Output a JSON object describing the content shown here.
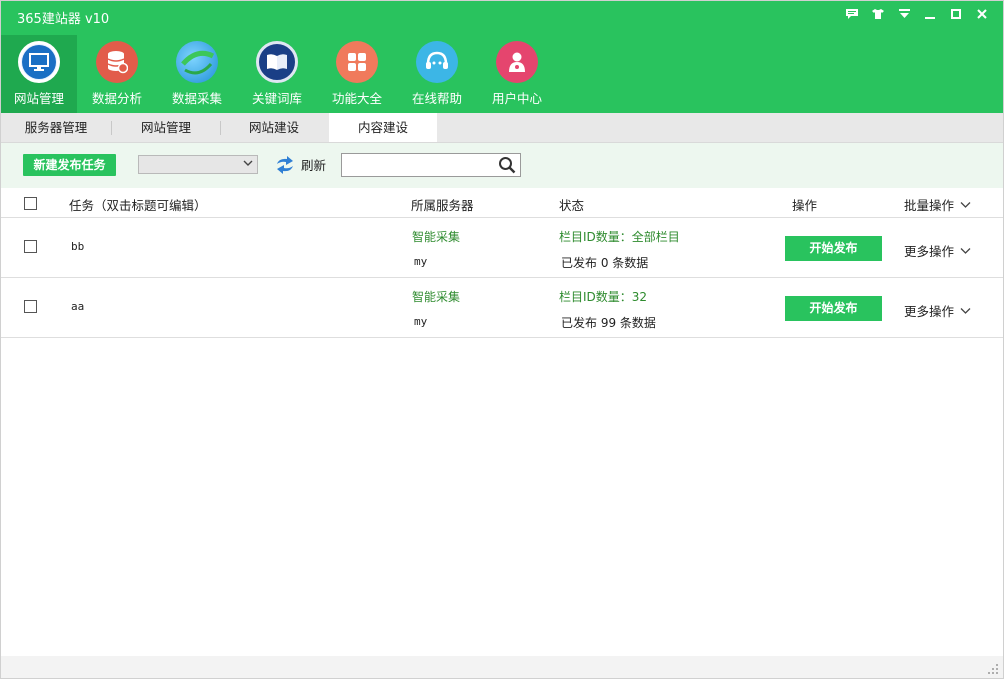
{
  "app": {
    "title": "365建站器 v10"
  },
  "window_controls": [
    {
      "name": "feedback-icon",
      "glyph": "▪"
    },
    {
      "name": "skin-icon",
      "glyph": "▪"
    },
    {
      "name": "menu-icon",
      "glyph": "▼"
    },
    {
      "name": "minimize-icon",
      "glyph": "—"
    },
    {
      "name": "maximize-icon",
      "glyph": "□"
    },
    {
      "name": "close-icon",
      "glyph": "✕"
    }
  ],
  "nav": {
    "items": [
      {
        "label": "网站管理",
        "icon": "monitor-icon",
        "color": "#1a6fc4",
        "active": true
      },
      {
        "label": "数据分析",
        "icon": "database-icon",
        "color": "#e25c4a",
        "active": false
      },
      {
        "label": "数据采集",
        "icon": "globe-icon",
        "color": "#1d8fd6",
        "active": false
      },
      {
        "label": "关键词库",
        "icon": "book-icon",
        "color": "#1a3f86",
        "active": false
      },
      {
        "label": "功能大全",
        "icon": "grid-icon",
        "color": "#f07a5c",
        "active": false
      },
      {
        "label": "在线帮助",
        "icon": "headset-icon",
        "color": "#3cb6e6",
        "active": false
      },
      {
        "label": "用户中心",
        "icon": "user-icon",
        "color": "#e5456e",
        "active": false
      }
    ]
  },
  "tabs": [
    {
      "label": "服务器管理",
      "active": false
    },
    {
      "label": "网站管理",
      "active": false
    },
    {
      "label": "网站建设",
      "active": false
    },
    {
      "label": "内容建设",
      "active": true
    }
  ],
  "toolbar": {
    "new_task_label": "新建发布任务",
    "select_value": "",
    "refresh_label": "刷新",
    "search_value": ""
  },
  "table": {
    "headers": {
      "task": "任务（双击标题可编辑）",
      "server": "所属服务器",
      "status": "状态",
      "action": "操作",
      "batch": "批量操作"
    },
    "rows": [
      {
        "task": "bb",
        "server_type": "智能采集",
        "server_name": "my",
        "status_line1": "栏目ID数量：全部栏目",
        "status_line2": "已发布 0 条数据",
        "publish_label": "开始发布",
        "more_label": "更多操作"
      },
      {
        "task": "aa",
        "server_type": "智能采集",
        "server_name": "my",
        "status_line1": "栏目ID数量：32",
        "status_line2": "已发布 99 条数据",
        "publish_label": "开始发布",
        "more_label": "更多操作"
      }
    ]
  },
  "colors": {
    "brand_green": "#29c35e",
    "active_nav": "#1fa94f",
    "status_green": "#2e8b2e"
  }
}
